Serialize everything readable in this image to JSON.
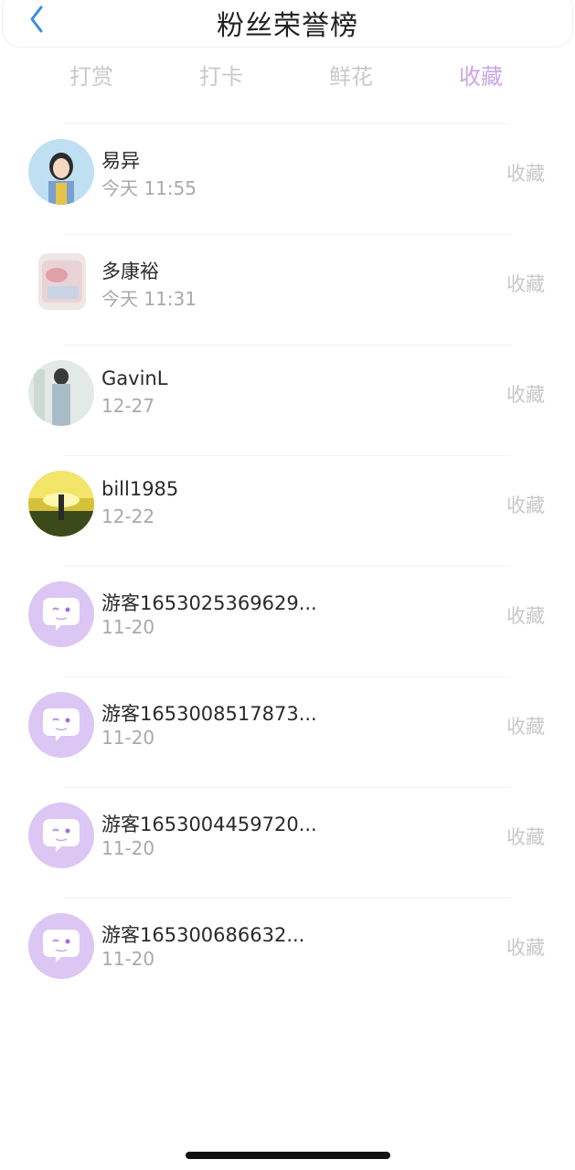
{
  "header": {
    "title": "粉丝荣誉榜"
  },
  "tabs": [
    {
      "label": "打赏"
    },
    {
      "label": "打卡"
    },
    {
      "label": "鲜花"
    },
    {
      "label": "收藏"
    }
  ],
  "activeTab": 3,
  "colors": {
    "accent": "#c9a6e6",
    "avatarGuest": "#dcc6f3",
    "backIcon": "#3a8fd9"
  },
  "list": [
    {
      "name": "易异",
      "time": "今天 11:55",
      "action": "收藏",
      "avatar": "photo-girl-avatar"
    },
    {
      "name": "多康裕",
      "time": "今天 11:31",
      "action": "收藏",
      "avatar": "photo-room-avatar"
    },
    {
      "name": "GavinL",
      "time": "12-27",
      "action": "收藏",
      "avatar": "photo-person-avatar"
    },
    {
      "name": "bill1985",
      "time": "12-22",
      "action": "收藏",
      "avatar": "photo-sunset-avatar"
    },
    {
      "name": "游客1653025369629...",
      "time": "11-20",
      "action": "收藏",
      "avatar": "guest-chat-avatar"
    },
    {
      "name": "游客1653008517873...",
      "time": "11-20",
      "action": "收藏",
      "avatar": "guest-chat-avatar"
    },
    {
      "name": "游客1653004459720...",
      "time": "11-20",
      "action": "收藏",
      "avatar": "guest-chat-avatar"
    },
    {
      "name": "游客165300686632...",
      "time": "11-20",
      "action": "收藏",
      "avatar": "guest-chat-avatar"
    }
  ]
}
